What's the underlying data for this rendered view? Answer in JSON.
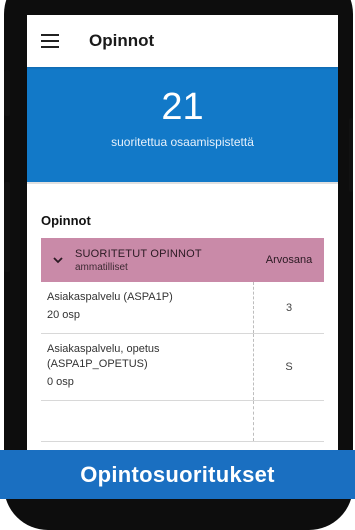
{
  "appbar": {
    "title": "Opinnot"
  },
  "hero": {
    "count": "21",
    "label": "suoritettua osaamispistettä"
  },
  "section": {
    "title": "Opinnot"
  },
  "table": {
    "header_title": "SUORITETUT OPINNOT",
    "header_subtitle": "ammatilliset",
    "grade_header": "Arvosana",
    "rows": [
      {
        "name": "Asiakaspalvelu (ASPA1P)",
        "credits": "20 osp",
        "grade": "3"
      },
      {
        "name": "Asiakaspalvelu, opetus (ASPA1P_OPETUS)",
        "credits": "0 osp",
        "grade": "S"
      }
    ]
  },
  "caption": "Opintosuoritukset",
  "colors": {
    "hero_bg": "#1279c8",
    "table_header_bg": "#c98aa8",
    "caption_bg": "#1a6fc1"
  }
}
